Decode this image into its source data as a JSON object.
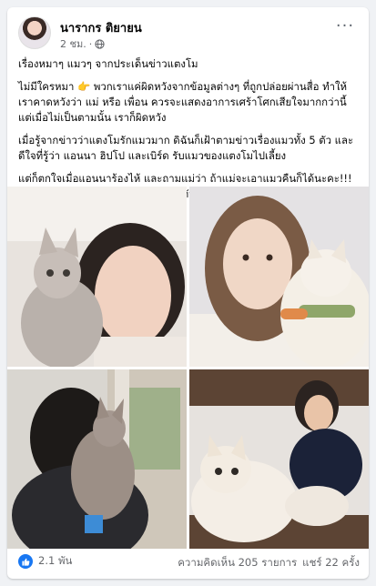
{
  "post": {
    "author": "นารากร ติยายน",
    "time": "2 ชม.",
    "privacy_icon": "globe-icon",
    "paragraphs": [
      "เรื่องหมาๆ แมวๆ จากประเด็นข่าวแตงโม",
      "ไม่มีใครหมา 👉 พวกเราแค่ผิดหวังจากข้อมูลต่างๆ ที่ถูกปล่อยผ่านสื่อ ทำให้เราคาดหวังว่า แม่ หรือ เพื่อน ควรจะแสดงอาการเศร้าโศกเสียใจมากกว่านี้ แต่เมื่อไม่เป็นตามนั้น เราก็ผิดหวัง",
      "เมื่อรู้จากข่าวว่าแตงโมรักแมวมาก ดิฉันก็เฝ้าตามข่าวเรื่องแมวทั้ง 5 ตัว และดีใจที่รู้ว่า แอนนา ฮิปโป และเบิร์ด รับแมวของแตงโมไปเลี้ยง",
      "แต่ก็ตกใจเมื่อแอนนาร้องไห้ และถามแม่ว่า ถ้าแม่จะเอาแมวคืนก็ได้นะคะ!!! 😲😲 ทำไมแอนนาถึงต้องถามคืนแมวกับแม่ ???"
    ]
  },
  "footer": {
    "likes": "2.1 พัน",
    "comments": "ความคิดเห็น 205 รายการ",
    "shares": "แชร์ 22 ครั้ง"
  },
  "colors": {
    "accent": "#1877f2",
    "muted": "#65676b"
  }
}
